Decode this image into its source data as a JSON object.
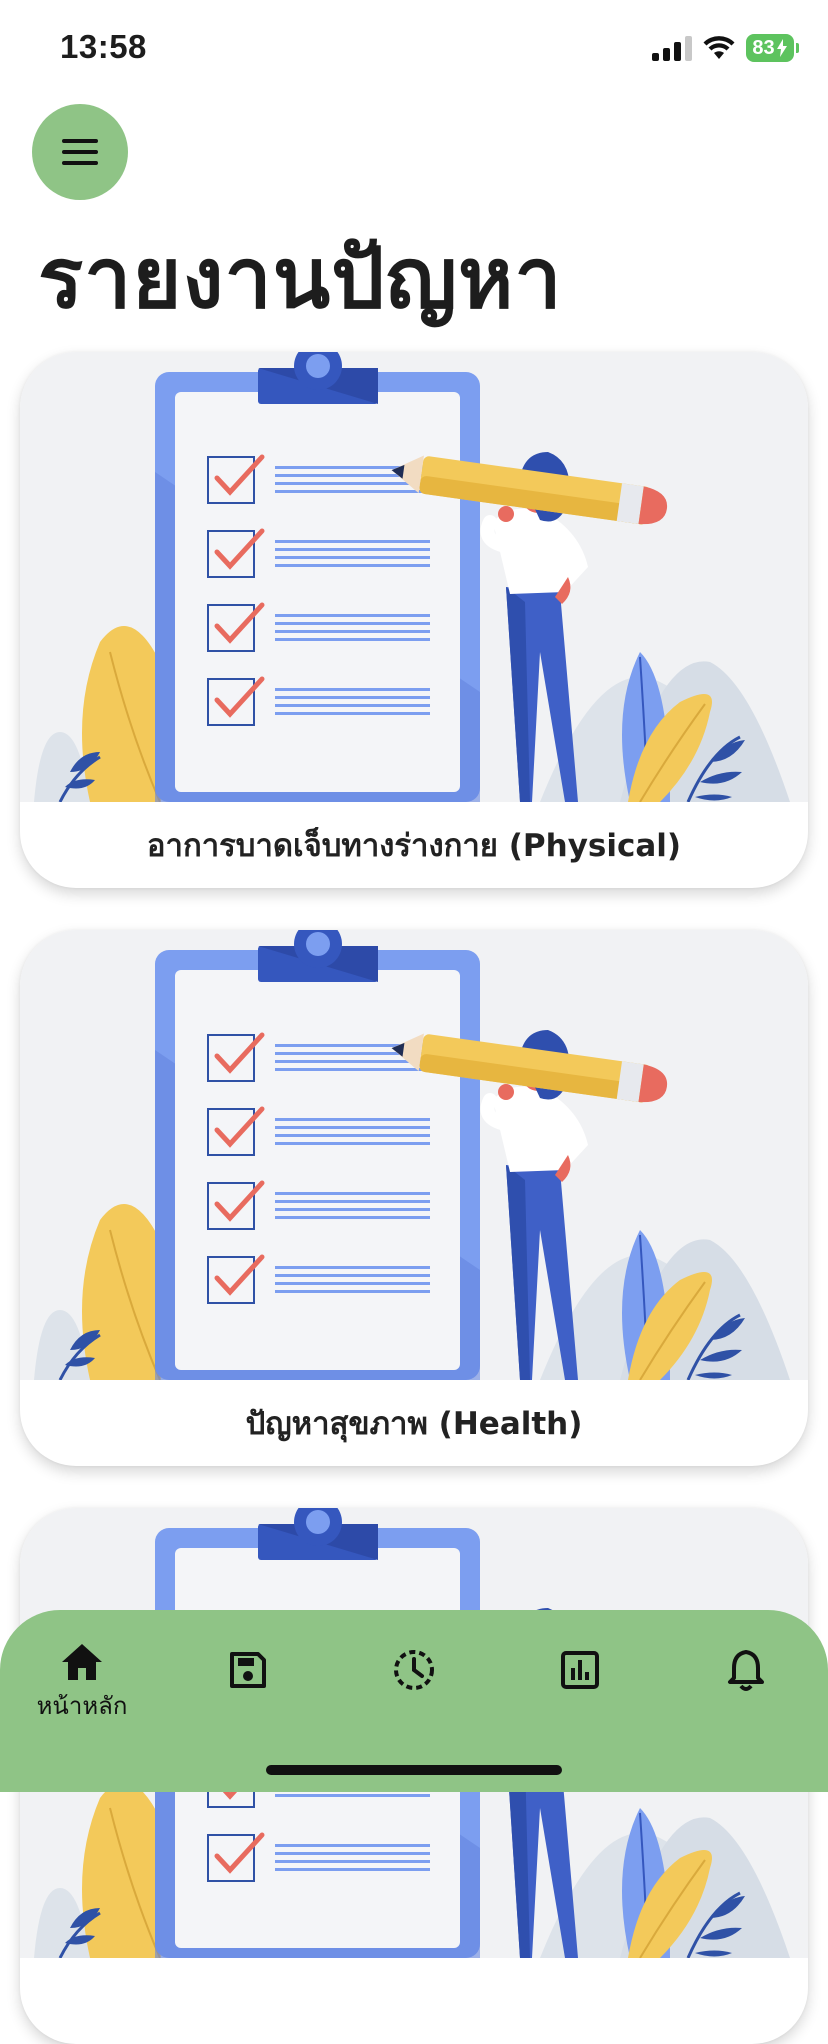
{
  "status_bar": {
    "time": "13:58",
    "battery": "83"
  },
  "page": {
    "title": "รายงานปัญหา"
  },
  "cards": [
    {
      "label": "อาการบาดเจ็บทางร่างกาย (Physical)"
    },
    {
      "label": "ปัญหาสุขภาพ (Health)"
    },
    {
      "label": ""
    }
  ],
  "bottom_nav": {
    "items": [
      {
        "icon": "home-icon",
        "label": "หน้าหลัก",
        "active": true
      },
      {
        "icon": "save-icon",
        "label": ""
      },
      {
        "icon": "history-icon",
        "label": ""
      },
      {
        "icon": "chart-icon",
        "label": ""
      },
      {
        "icon": "bell-icon",
        "label": ""
      }
    ]
  },
  "colors": {
    "accent": "#8fc486",
    "card_background": "#f1f2f4",
    "clipboard_blue": "#6d8fe8",
    "pencil_yellow": "#f3c95a",
    "check_red": "#e86b5f"
  }
}
